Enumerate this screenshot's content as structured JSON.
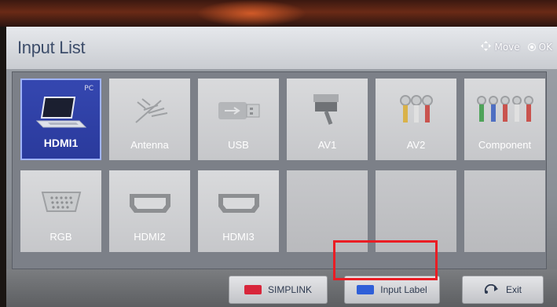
{
  "header": {
    "title": "Input List",
    "move_label": "Move",
    "ok_label": "OK",
    "move_icon": "four-way-arrow-icon",
    "ok_icon": "ok-button-icon"
  },
  "inputs": [
    {
      "label": "HDMI1",
      "tag": "PC",
      "icon": "laptop-icon",
      "selected": true
    },
    {
      "label": "Antenna",
      "icon": "antenna-icon"
    },
    {
      "label": "USB",
      "icon": "usb-icon"
    },
    {
      "label": "AV1",
      "icon": "scart-icon"
    },
    {
      "label": "AV2",
      "icon": "rca-av-icon"
    },
    {
      "label": "Component",
      "icon": "component-icon"
    },
    {
      "label": "RGB",
      "icon": "vga-icon"
    },
    {
      "label": "HDMI2",
      "icon": "hdmi-icon"
    },
    {
      "label": "HDMI3",
      "icon": "hdmi-icon"
    }
  ],
  "footer": {
    "simplink_label": "SIMPLINK",
    "input_label_label": "Input Label",
    "exit_label": "Exit"
  },
  "colors": {
    "selected_tile": "#2a3a9c",
    "simplink_swatch": "#d8263b",
    "input_label_swatch": "#2f5fd8",
    "highlight": "#ea1d24"
  }
}
